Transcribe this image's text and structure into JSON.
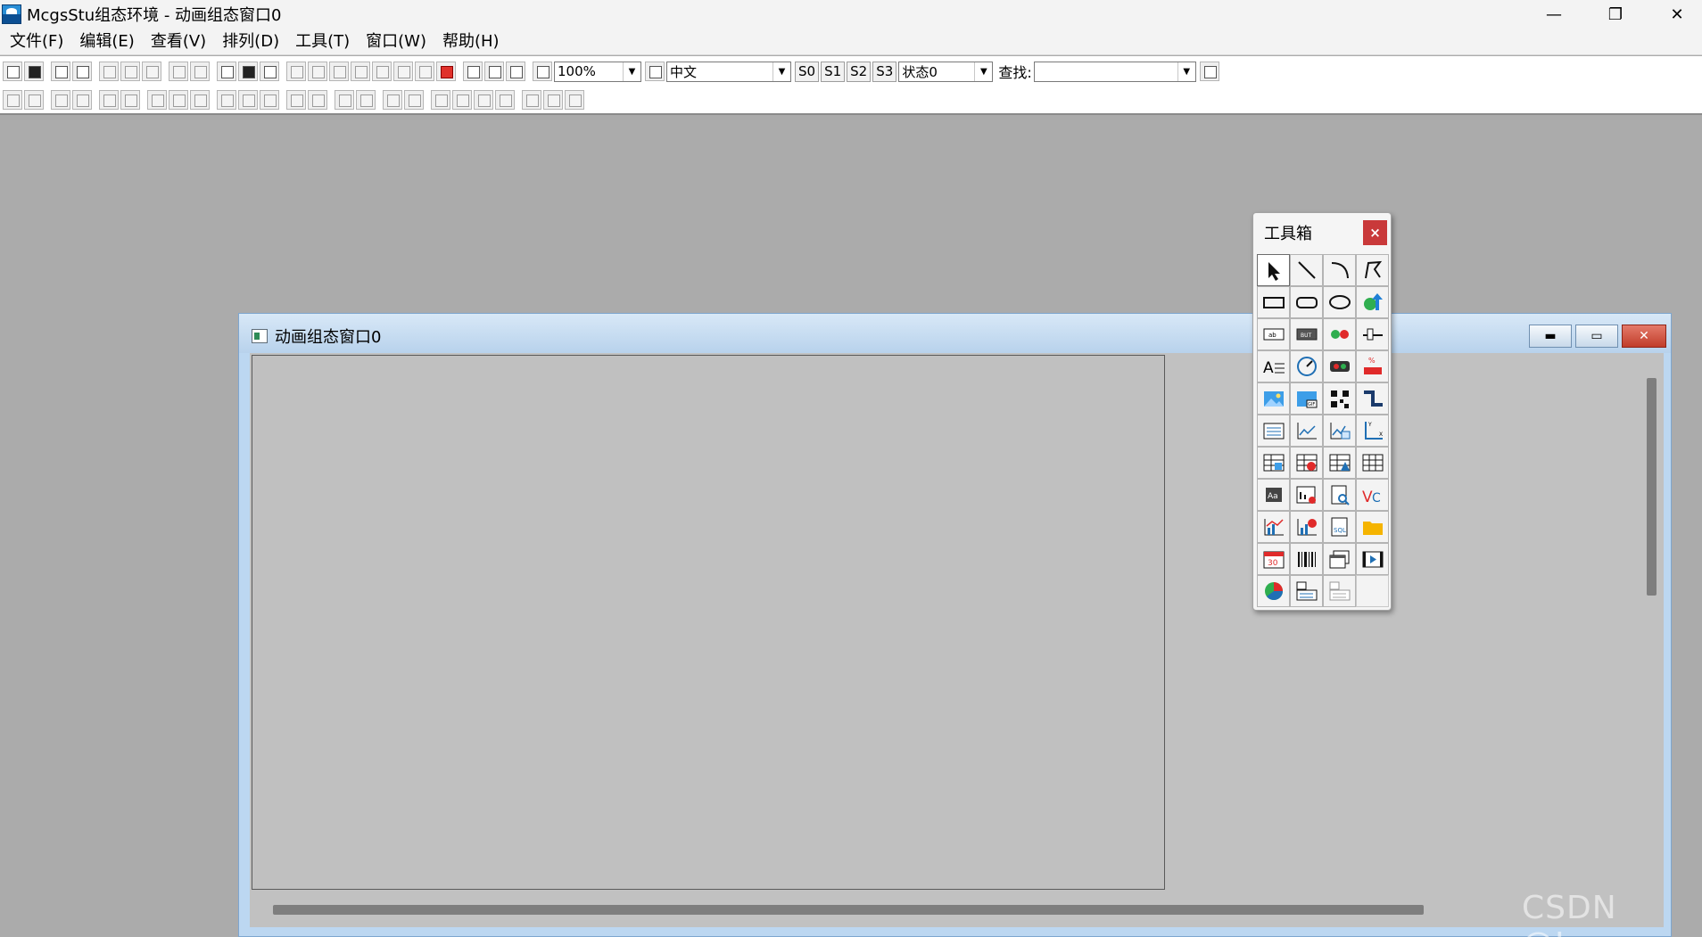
{
  "app": {
    "title": "McgsStu组态环境 - 动画组态窗口0",
    "icon": "mcgs-app-icon",
    "controls": {
      "minimize": "—",
      "maximize": "❐",
      "close": "✕"
    }
  },
  "menubar": {
    "items": [
      "文件(F)",
      "编辑(E)",
      "查看(V)",
      "排列(D)",
      "工具(T)",
      "窗口(W)",
      "帮助(H)"
    ]
  },
  "toolbar": {
    "zoom": "100%",
    "language": "中文",
    "state_buttons": [
      "S0",
      "S1",
      "S2",
      "S3"
    ],
    "state_select": "状态0",
    "find_label": "查找:",
    "find_value": ""
  },
  "child_window": {
    "title": "动画组态窗口0",
    "controls": {
      "minimize": "▬",
      "maximize": "▭",
      "close": "✕"
    }
  },
  "toolbox": {
    "title": "工具箱",
    "close": "×",
    "tools": [
      "pointer-tool",
      "line-tool",
      "arc-tool",
      "polyline-tool",
      "rectangle-tool",
      "rounded-rectangle-tool",
      "ellipse-tool",
      "flow-block-tool",
      "label-tool",
      "standard-button-tool",
      "indicator-light-tool",
      "slider-input-tool",
      "text-align-tool",
      "dial-gauge-tool",
      "animation-button-tool",
      "percent-fill-tool",
      "image-tool",
      "gif-image-tool",
      "qr-code-tool",
      "flow-pipe-tool",
      "list-box-tool",
      "realtime-curve-tool",
      "history-curve-tool",
      "xy-curve-tool",
      "custom-table-tool",
      "alarm-table-tool",
      "history-table-tool",
      "grid-table-tool",
      "input-box-tool",
      "alarm-display-tool",
      "report-browse-tool",
      "vc-control-tool",
      "bar-chart-tool",
      "alarm-bar-chart-tool",
      "sql-query-tool",
      "folder-tool",
      "calendar-tool",
      "barcode-tool",
      "subwindow-tool",
      "video-tool",
      "pie-chart-tool",
      "combo-box-tool",
      "disabled-combo-tool",
      ""
    ],
    "selected_index": 0
  },
  "watermark": "CSDN @Loo"
}
